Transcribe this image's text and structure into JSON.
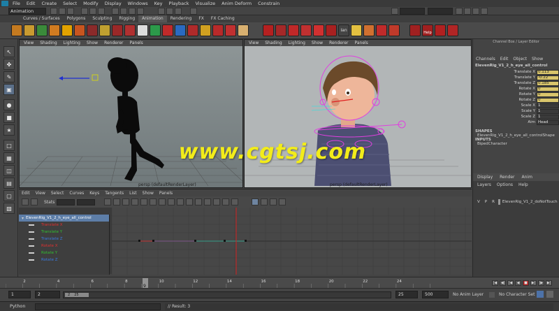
{
  "menubar": {
    "items": [
      "File",
      "Edit",
      "Create",
      "Select",
      "Modify",
      "Display",
      "Windows",
      "Key",
      "Playback",
      "Visualize",
      "Anim Deform",
      "Constrain"
    ]
  },
  "statusline": {
    "mode": "Animation"
  },
  "shelf": {
    "tabs": [
      "Curves / Surfaces",
      "Polygons",
      "Sculpting",
      "Rigging",
      "Animation",
      "Rendering",
      "FX",
      "FX Caching"
    ],
    "active_tab": "Animation",
    "label_mid": "Ian",
    "label_help": "Help"
  },
  "viewport_left": {
    "menu": [
      "View",
      "Shading",
      "Lighting",
      "Show",
      "Renderer",
      "Panels"
    ],
    "camera": "persp (defaultRenderLayer)"
  },
  "viewport_right": {
    "menu": [
      "View",
      "Shading",
      "Lighting",
      "Show",
      "Renderer",
      "Panels"
    ],
    "camera": "persp (defaultRenderLayer)"
  },
  "watermark": "www.cgtsj.com",
  "channelbox": {
    "tabs": [
      "Channels",
      "Edit",
      "Object",
      "Show"
    ],
    "title": "Channel Box / Layer Editor",
    "object": "ElevenRig_V1_2_h_eye_all_control",
    "attrs": [
      {
        "name": "Translate X",
        "value": "0.113",
        "keyed": true
      },
      {
        "name": "Translate Y",
        "value": "-0.22",
        "keyed": true
      },
      {
        "name": "Translate Z",
        "value": "0.185",
        "keyed": true
      },
      {
        "name": "Rotate X",
        "value": "0",
        "keyed": true
      },
      {
        "name": "Rotate Y",
        "value": "0",
        "keyed": true
      },
      {
        "name": "Rotate Z",
        "value": "0",
        "keyed": true
      },
      {
        "name": "Scale X",
        "value": "1",
        "keyed": false
      },
      {
        "name": "Scale Y",
        "value": "1",
        "keyed": false
      },
      {
        "name": "Scale Z",
        "value": "1",
        "keyed": false
      },
      {
        "name": "Aim",
        "value": "Head",
        "keyed": false
      }
    ],
    "shapes_header": "SHAPES",
    "shape": "ElevenRig_V1_2_h_eye_all_controlShape",
    "inputs_header": "INPUTS",
    "input": "BipedCharacter"
  },
  "layereditor": {
    "tabs": [
      "Display",
      "Render",
      "Anim"
    ],
    "menu": [
      "Layers",
      "Options",
      "Help"
    ],
    "row": {
      "v": "V",
      "p": "P",
      "r": "R",
      "name": "ElevenRig_V1_2_doNotTouch"
    }
  },
  "graph": {
    "menu": [
      "Edit",
      "View",
      "Select",
      "Curves",
      "Keys",
      "Tangents",
      "List",
      "Show",
      "Panels"
    ],
    "stats": "Stats",
    "outliner_root": "ElevenRig_V1_2_h_eye_all_control",
    "curves": [
      {
        "name": "Translate X",
        "color": "#e03030"
      },
      {
        "name": "Translate Y",
        "color": "#30c030"
      },
      {
        "name": "Translate Z",
        "color": "#3a7ae0"
      },
      {
        "name": "Rotate X",
        "color": "#e03030"
      },
      {
        "name": "Rotate Y",
        "color": "#30c030"
      },
      {
        "name": "Rotate Z",
        "color": "#3a7ae0"
      }
    ]
  },
  "timeline": {
    "ticks": [
      "2",
      "4",
      "6",
      "8",
      "9",
      "10",
      "12",
      "14",
      "16",
      "18",
      "20",
      "22",
      "24"
    ],
    "current_frame": "9",
    "range_start": "1",
    "range_start_inner": "2",
    "range_handle_a": "2",
    "range_handle_b": "25",
    "range_end_inner": "25",
    "range_end": "500",
    "anim_layer": "No Anim Layer",
    "char_set": "No Character Set"
  },
  "cmdline": {
    "lang": "Python",
    "result": "// Result: 3"
  }
}
